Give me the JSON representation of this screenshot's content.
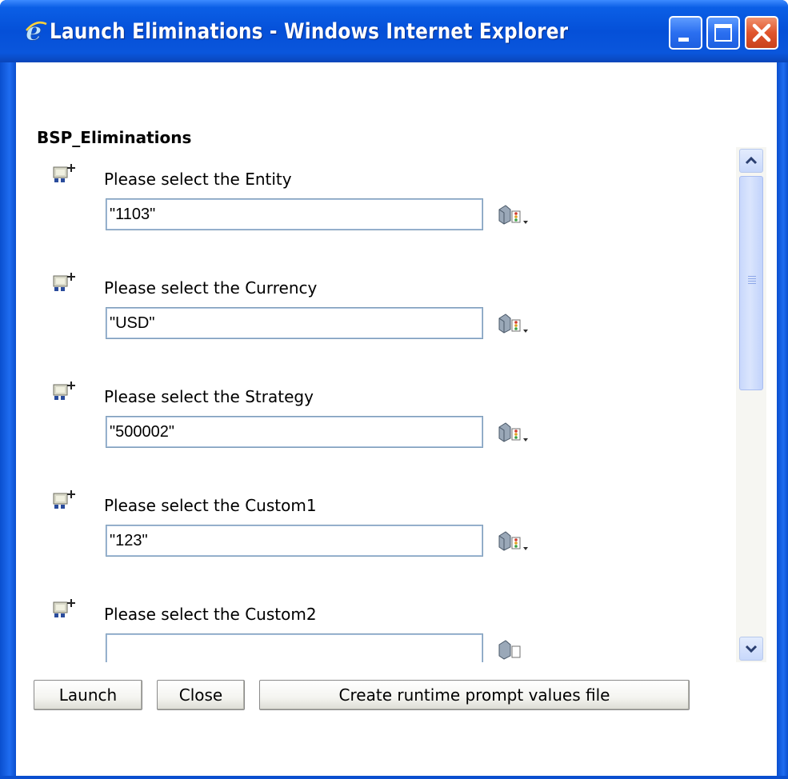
{
  "window": {
    "title": "Launch Eliminations - Windows Internet Explorer",
    "controls": [
      "minimize",
      "maximize",
      "close"
    ],
    "accent_color": "#0a56dc",
    "close_color": "#e0552d"
  },
  "page": {
    "heading": "BSP_Eliminations"
  },
  "prompts": [
    {
      "label": "Please select the Entity",
      "value": "\"1103\"",
      "icon": "member-selection-icon"
    },
    {
      "label": "Please select the Currency",
      "value": "\"USD\"",
      "icon": "member-selection-icon"
    },
    {
      "label": "Please select the Strategy",
      "value": "\"500002\"",
      "icon": "member-selection-icon"
    },
    {
      "label": "Please select the Custom1",
      "value": "\"123\"",
      "icon": "member-selection-icon"
    },
    {
      "label": "Please select the Custom2",
      "value": "",
      "icon": "member-selection-icon"
    }
  ],
  "buttons": {
    "launch": "Launch",
    "close": "Close",
    "create_rtp": "Create runtime prompt values file"
  }
}
